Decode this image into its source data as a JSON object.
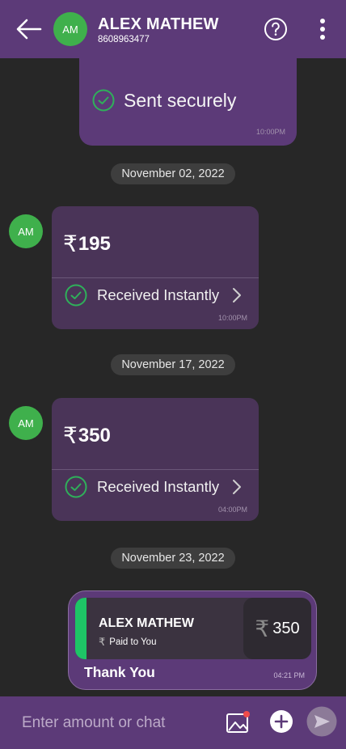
{
  "header": {
    "avatar_initials": "AM",
    "name": "ALEX MATHEW",
    "phone": "8608963477",
    "icons": [
      "back-arrow-icon",
      "help-icon",
      "more-vert-icon"
    ]
  },
  "messages": {
    "sent": {
      "status": "Sent securely",
      "time": "10:00PM"
    },
    "date1": "November 02, 2022",
    "recv1": {
      "avatar": "AM",
      "currency": "₹",
      "amount": "195",
      "status": "Received Instantly",
      "time": "10:00PM"
    },
    "date2": "November 17, 2022",
    "recv2": {
      "avatar": "AM",
      "currency": "₹",
      "amount": "350",
      "status": "Received Instantly",
      "time": "04:00PM"
    },
    "date3": "November 23, 2022",
    "card": {
      "name": "ALEX MATHEW",
      "currency": "₹",
      "paid_label": "Paid to You",
      "amount": "350",
      "note": "Thank You",
      "time": "04:21 PM"
    }
  },
  "footer": {
    "placeholder": "Enter amount or chat",
    "icons": [
      "gallery-icon",
      "add-icon",
      "send-icon"
    ]
  },
  "colors": {
    "header": "#5c3a78",
    "background": "#272727",
    "bubble": "#4a3458",
    "avatar": "#3fb04c",
    "check": "#2fb05a"
  }
}
